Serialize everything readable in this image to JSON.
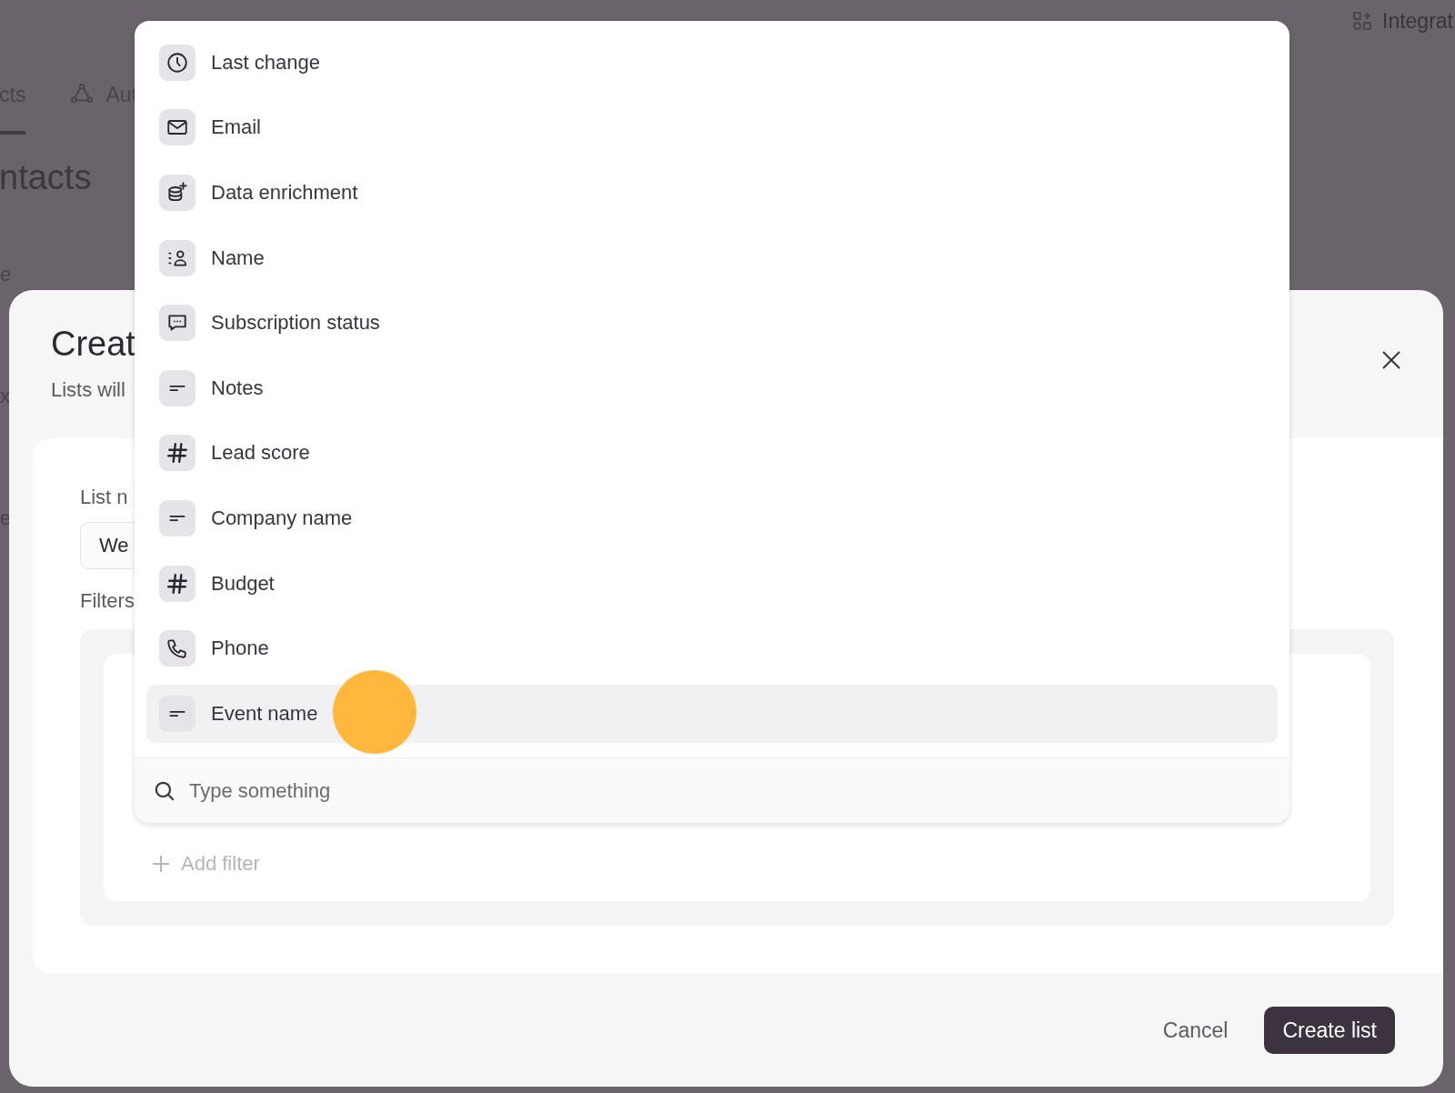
{
  "background": {
    "top_right_link": "Integrat",
    "tabs": [
      {
        "label": "cts",
        "selected": true
      },
      {
        "label": "Aut",
        "selected": false
      }
    ],
    "heading": "ntacts",
    "edge_fragments": [
      "e",
      "x",
      "e"
    ]
  },
  "modal": {
    "title": "Creat",
    "subtitle": "Lists will",
    "list_name": {
      "label": "List n",
      "value": "We"
    },
    "filters_label": "Filters",
    "add_filter": "Add filter",
    "buttons": [
      {
        "label": "Cancel",
        "kind": "secondary"
      },
      {
        "label": "Create list",
        "kind": "primary"
      }
    ]
  },
  "dropdown": {
    "items": [
      {
        "label": "Last change",
        "kind": "clock",
        "selected": false
      },
      {
        "label": "Email",
        "kind": "mail",
        "selected": false
      },
      {
        "label": "Data enrichment",
        "kind": "database",
        "selected": false
      },
      {
        "label": "Name",
        "kind": "person",
        "selected": false
      },
      {
        "label": "Subscription status",
        "kind": "chat",
        "selected": false
      },
      {
        "label": "Notes",
        "kind": "text",
        "selected": false
      },
      {
        "label": "Lead score",
        "kind": "number",
        "selected": false
      },
      {
        "label": "Company name",
        "kind": "text",
        "selected": false
      },
      {
        "label": "Budget",
        "kind": "number",
        "selected": false
      },
      {
        "label": "Phone",
        "kind": "phone",
        "selected": false
      },
      {
        "label": "Event name",
        "kind": "text",
        "selected": true
      }
    ],
    "search": {
      "placeholder": "Type something"
    }
  }
}
